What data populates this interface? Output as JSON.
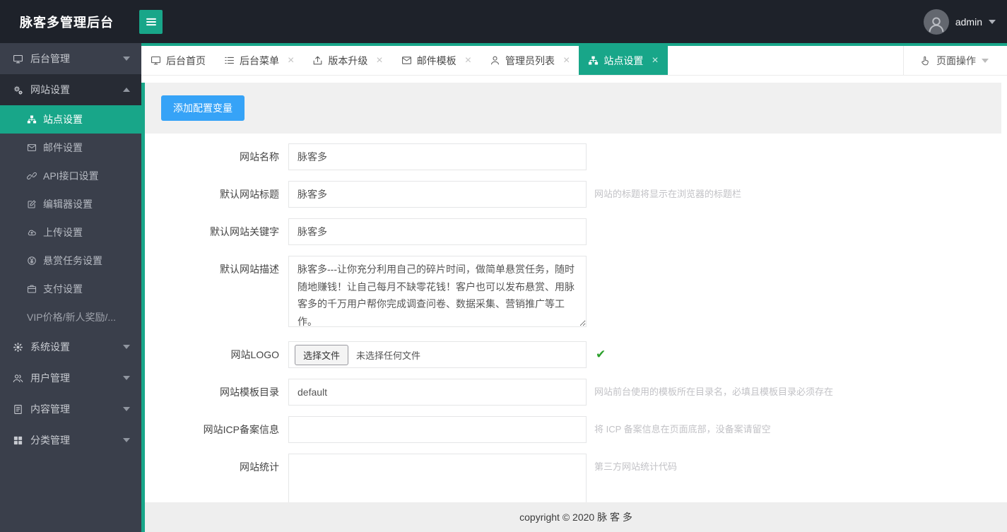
{
  "app": {
    "title": "脉客多管理后台",
    "username": "admin"
  },
  "colors": {
    "accent_teal": "#18a689",
    "header_bg": "#1e222a",
    "sidebar_bg": "#3a3f4b",
    "sidebar_open_bg": "#272b34",
    "button_blue": "#36a3f7",
    "panel_gray": "#f0f0f0",
    "footer_gray": "#eeeeee",
    "check_green": "#2ba02b"
  },
  "sidebar": {
    "items": [
      {
        "label": "后台管理",
        "icon": "monitor-icon"
      },
      {
        "label": "网站设置",
        "icon": "gears-icon"
      },
      {
        "label": "系统设置",
        "icon": "gear-icon"
      },
      {
        "label": "用户管理",
        "icon": "users-icon"
      },
      {
        "label": "内容管理",
        "icon": "document-icon"
      },
      {
        "label": "分类管理",
        "icon": "grid-icon"
      }
    ],
    "submenu": [
      {
        "label": "站点设置",
        "icon": "sitemap-icon"
      },
      {
        "label": "邮件设置",
        "icon": "mail-icon"
      },
      {
        "label": "API接口设置",
        "icon": "link-icon"
      },
      {
        "label": "编辑器设置",
        "icon": "edit-icon"
      },
      {
        "label": "上传设置",
        "icon": "cloud-upload-icon"
      },
      {
        "label": "悬赏任务设置",
        "icon": "yen-circle-icon"
      },
      {
        "label": "支付设置",
        "icon": "wallet-icon"
      },
      {
        "label": "VIP价格/新人奖励/...",
        "icon": ""
      }
    ]
  },
  "tabs": [
    {
      "label": "后台首页",
      "icon": "monitor-icon",
      "close": ""
    },
    {
      "label": "后台菜单",
      "icon": "list-icon",
      "close": "×"
    },
    {
      "label": "版本升级",
      "icon": "upload-icon",
      "close": "×"
    },
    {
      "label": "邮件模板",
      "icon": "mail-icon",
      "close": "×"
    },
    {
      "label": "管理员列表",
      "icon": "user-icon",
      "close": "×"
    },
    {
      "label": "站点设置",
      "icon": "sitemap-icon",
      "close": "×"
    }
  ],
  "page_ops": {
    "label": "页面操作",
    "icon": "hand-pointer-icon"
  },
  "toolbar": {
    "add_button": "添加配置变量"
  },
  "form": {
    "fields": [
      {
        "label": "网站名称",
        "value": "脉客多",
        "hint": ""
      },
      {
        "label": "默认网站标题",
        "value": "脉客多",
        "hint": "网站的标题将显示在浏览器的标题栏"
      },
      {
        "label": "默认网站关键字",
        "value": "脉客多",
        "hint": ""
      },
      {
        "label": "默认网站描述",
        "value": "脉客多---让你充分利用自己的碎片时间，做简单悬赏任务，随时随地赚钱！让自己每月不缺零花钱！客户也可以发布悬赏、用脉客多的千万用户帮你完成调查问卷、数据采集、营销推广等工作。",
        "hint": ""
      },
      {
        "label": "网站LOGO",
        "file_button": "选择文件",
        "file_text": "未选择任何文件",
        "check": "✔"
      },
      {
        "label": "网站模板目录",
        "value": "default",
        "hint": "网站前台使用的模板所在目录名，必填且模板目录必须存在"
      },
      {
        "label": "网站ICP备案信息",
        "value": "",
        "hint": "将 ICP 备案信息在页面底部，没备案请留空"
      },
      {
        "label": "网站统计",
        "value": "",
        "hint": "第三方网站统计代码"
      }
    ]
  },
  "footer": {
    "copyright": "copyright © 2020 脉 客 多"
  }
}
